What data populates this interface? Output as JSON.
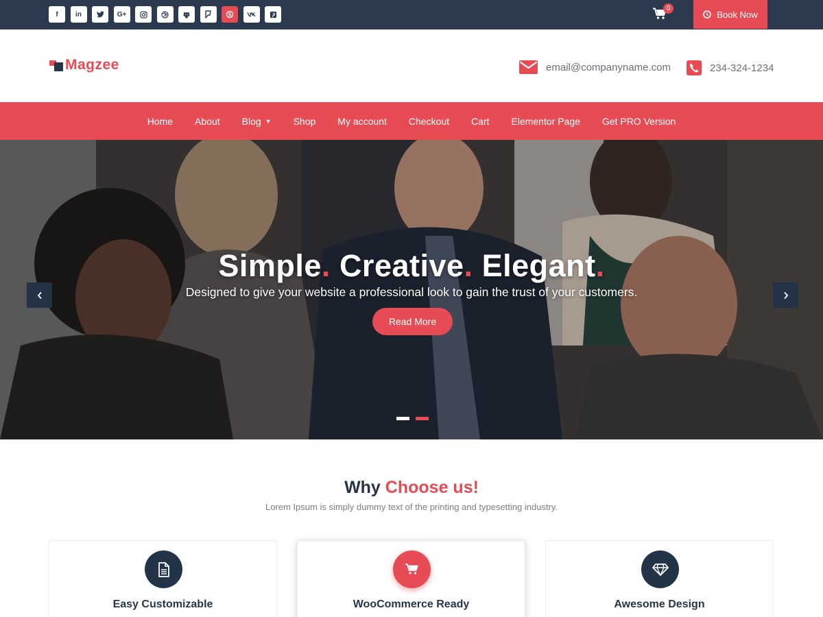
{
  "topbar": {
    "socials": [
      {
        "icon": "facebook-icon",
        "glyph": "f"
      },
      {
        "icon": "linkedin-icon",
        "glyph": "in"
      },
      {
        "icon": "twitter-icon",
        "glyph": ""
      },
      {
        "icon": "google-plus-icon",
        "glyph": "G+"
      },
      {
        "icon": "instagram-icon",
        "glyph": ""
      },
      {
        "icon": "dribbble-icon",
        "glyph": ""
      },
      {
        "icon": "github-icon",
        "glyph": ""
      },
      {
        "icon": "foursquare-icon",
        "glyph": ""
      },
      {
        "icon": "skype-icon",
        "glyph": ""
      },
      {
        "icon": "vk-icon",
        "glyph": ""
      },
      {
        "icon": "pinterest-icon",
        "glyph": ""
      }
    ],
    "cart_count": "0",
    "book_now_label": "Book Now",
    "accent_color": "#e74c55",
    "bar_color": "#2b3a4e"
  },
  "header": {
    "logo_text": "Magzee",
    "email": "email@companyname.com",
    "phone": "234-324-1234"
  },
  "nav": {
    "items": [
      "Home",
      "About",
      "Blog",
      "Shop",
      "My account",
      "Checkout",
      "Cart",
      "Elementor Page",
      "Get PRO Version"
    ]
  },
  "hero": {
    "title_parts": [
      "Simple",
      "Creative",
      "Elegant"
    ],
    "title_dot": ".",
    "subtitle": "Designed to give your website a professional look to gain the trust of your customers.",
    "button_label": "Read More",
    "slide_count": 2,
    "active_slide": 2
  },
  "why": {
    "title_plain": "Why",
    "title_accent": "Choose us!",
    "subtitle": "Lorem Ipsum is simply dummy text of the printing and typesetting industry.",
    "cards": [
      {
        "title": "Easy Customizable",
        "icon": "document-icon"
      },
      {
        "title": "WooCommerce Ready",
        "icon": "cart-icon"
      },
      {
        "title": "Awesome Design",
        "icon": "diamond-icon"
      }
    ]
  }
}
